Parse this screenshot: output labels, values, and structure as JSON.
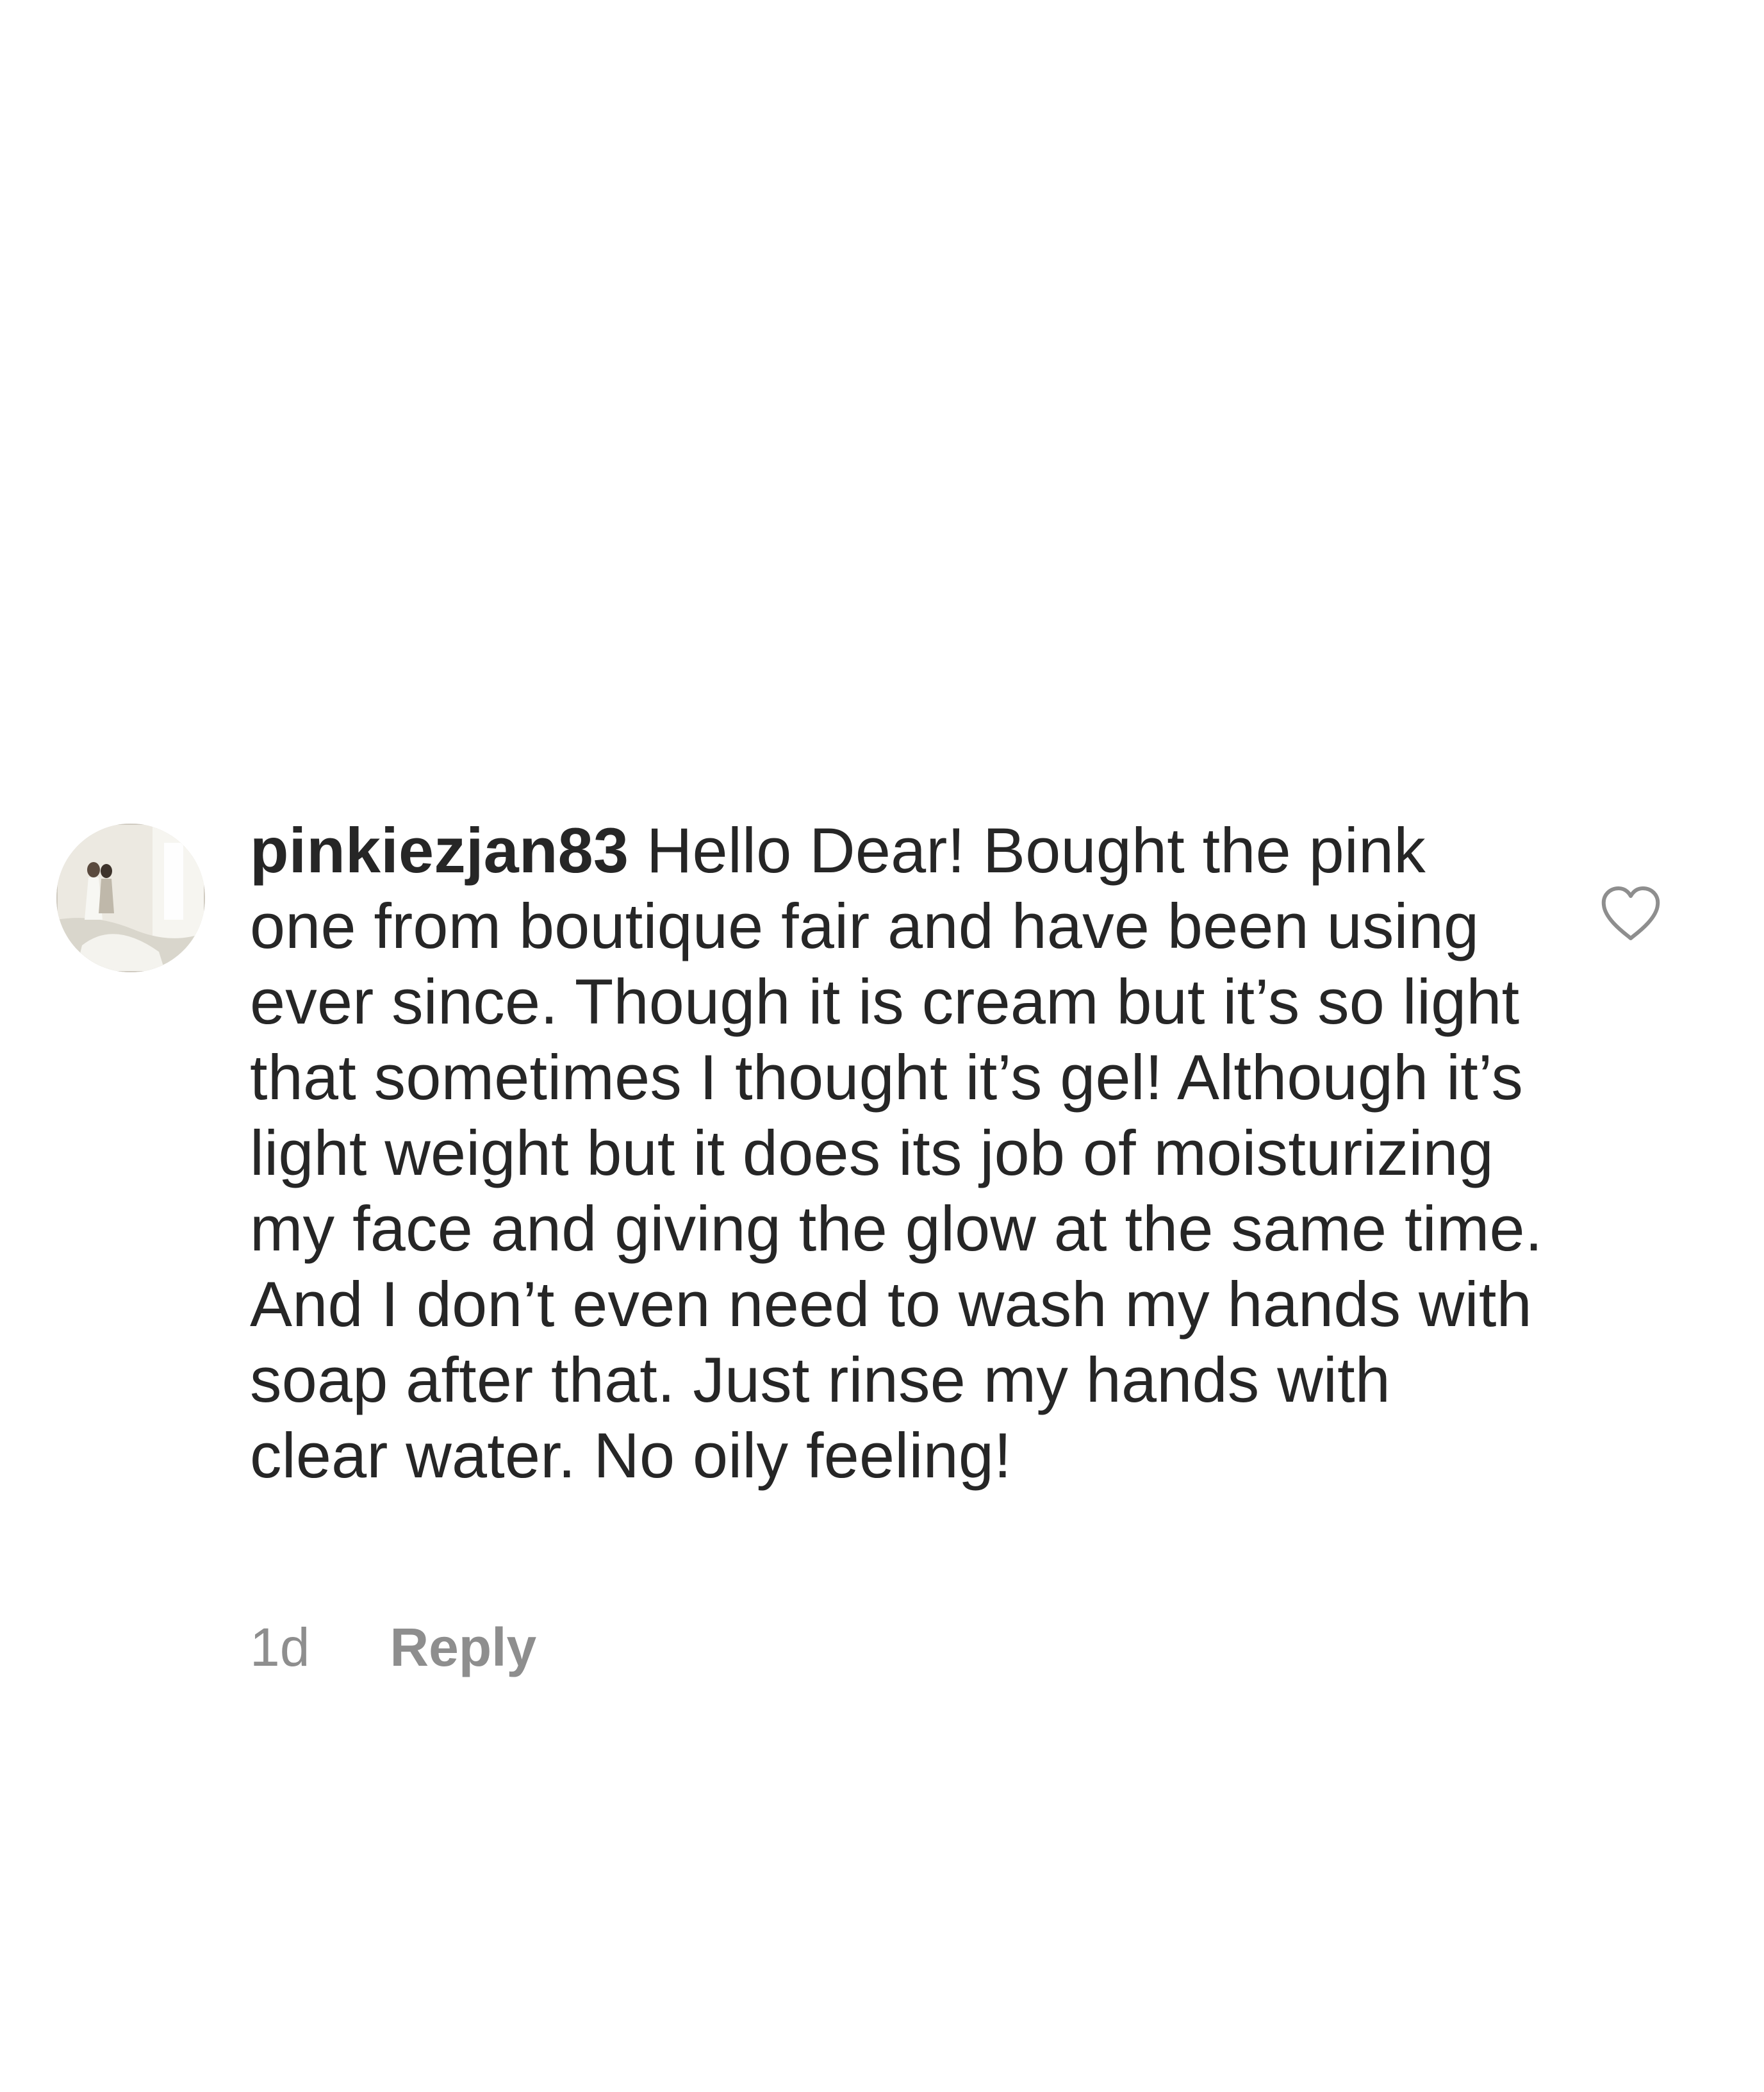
{
  "comment": {
    "username": "pinkiezjan83",
    "text": "Hello Dear! Bought the pink one from boutique fair and have been using ever since. Though it is cream but it’s so light that sometimes I thought it’s gel! Although it’s light weight but it does its job of moisturizing my face and giving the glow at the same time. And I don’t even need to wash my hands with soap after that. Just rinse my hands with clear water. No oily feeling!",
    "time": "1d",
    "reply_label": "Reply"
  },
  "icons": {
    "like": "heart-outline-icon",
    "avatar": "profile-photo"
  },
  "colors": {
    "text": "#262626",
    "secondary_text": "#8e8e8e",
    "background": "#ffffff"
  }
}
